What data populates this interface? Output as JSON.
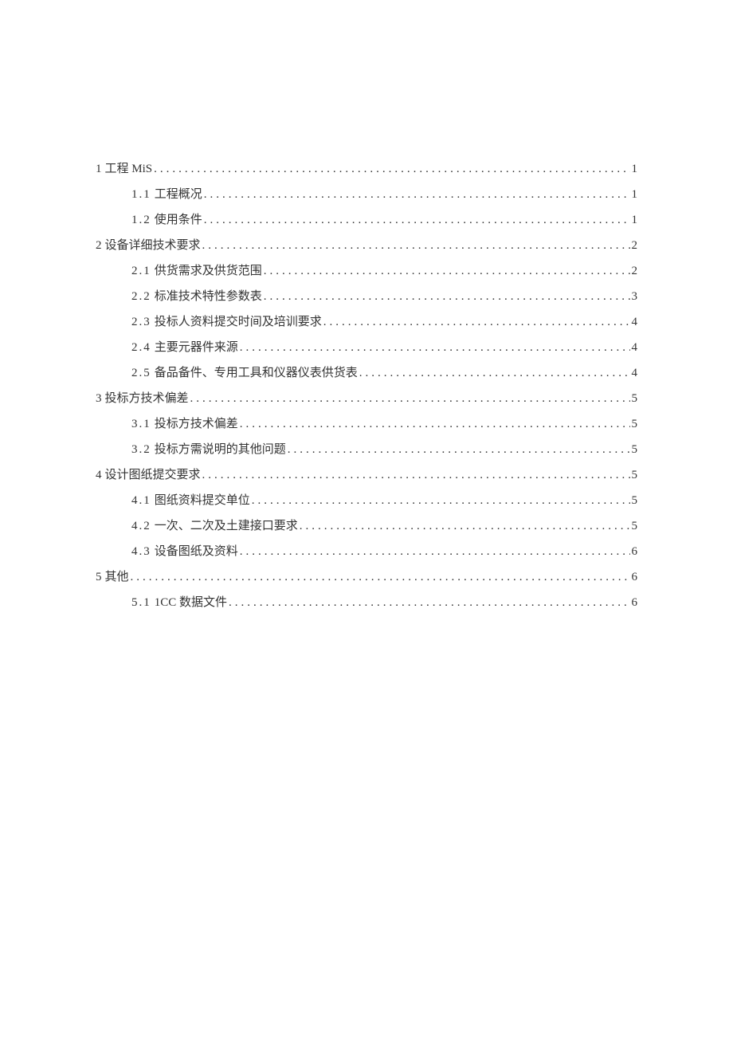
{
  "toc": [
    {
      "level": 1,
      "num": "1",
      "title": "工程 MiS",
      "page": "1"
    },
    {
      "level": 2,
      "num": "1.1",
      "title": "工程概况",
      "page": "1"
    },
    {
      "level": 2,
      "num": "1.2",
      "title": "使用条件",
      "page": "1"
    },
    {
      "level": 1,
      "num": "2",
      "title": "设备详细技术要求",
      "page": "2"
    },
    {
      "level": 2,
      "num": "2.1",
      "title": "供货需求及供货范围",
      "page": "2"
    },
    {
      "level": 2,
      "num": "2.2",
      "title": "标准技术特性参数表",
      "page": "3"
    },
    {
      "level": 2,
      "num": "2.3",
      "title": "投标人资料提交时间及培训要求",
      "page": "4"
    },
    {
      "level": 2,
      "num": "2.4",
      "title": "主要元器件来源",
      "page": "4"
    },
    {
      "level": 2,
      "num": "2.5",
      "title": "备品备件、专用工具和仪器仪表供货表",
      "page": "4"
    },
    {
      "level": 1,
      "num": "3",
      "title": "投标方技术偏差",
      "page": "5"
    },
    {
      "level": 2,
      "num": "3.1",
      "title": "投标方技术偏差",
      "page": "5"
    },
    {
      "level": 2,
      "num": "3.2",
      "title": "投标方需说明的其他问题",
      "page": "5"
    },
    {
      "level": 1,
      "num": "4",
      "title": "设计图纸提交要求",
      "page": "5"
    },
    {
      "level": 2,
      "num": "4.1",
      "title": "图纸资料提交单位",
      "page": "5"
    },
    {
      "level": 2,
      "num": "4.2",
      "title": "一次、二次及土建接口要求",
      "page": "5"
    },
    {
      "level": 2,
      "num": "4.3",
      "title": "设备图纸及资料",
      "page": "6"
    },
    {
      "level": 1,
      "num": "5",
      "title": "其他",
      "page": "6"
    },
    {
      "level": 2,
      "num": "5.1",
      "title": "1CC 数据文件",
      "page": "6"
    }
  ]
}
